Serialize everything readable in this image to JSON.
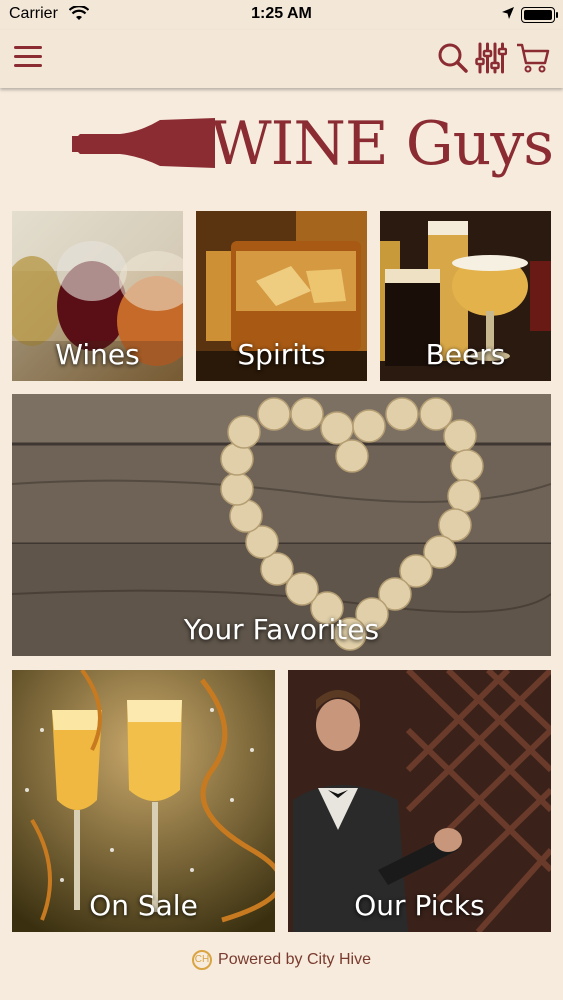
{
  "status_bar": {
    "carrier": "Carrier",
    "time": "1:25 AM"
  },
  "navbar": {
    "icons": [
      "hamburger-menu-icon",
      "search-icon",
      "filter-icon",
      "cart-icon"
    ]
  },
  "logo": {
    "text": "WINE Guys"
  },
  "categories": [
    {
      "label": "Wines"
    },
    {
      "label": "Spirits"
    },
    {
      "label": "Beers"
    },
    {
      "label": "Your Favorites"
    },
    {
      "label": "On Sale"
    },
    {
      "label": "Our Picks"
    }
  ],
  "footer": {
    "text": "Powered by City Hive"
  },
  "colors": {
    "brand": "#8b2c33",
    "background": "#f6ebdd",
    "accent": "#d9a441"
  }
}
